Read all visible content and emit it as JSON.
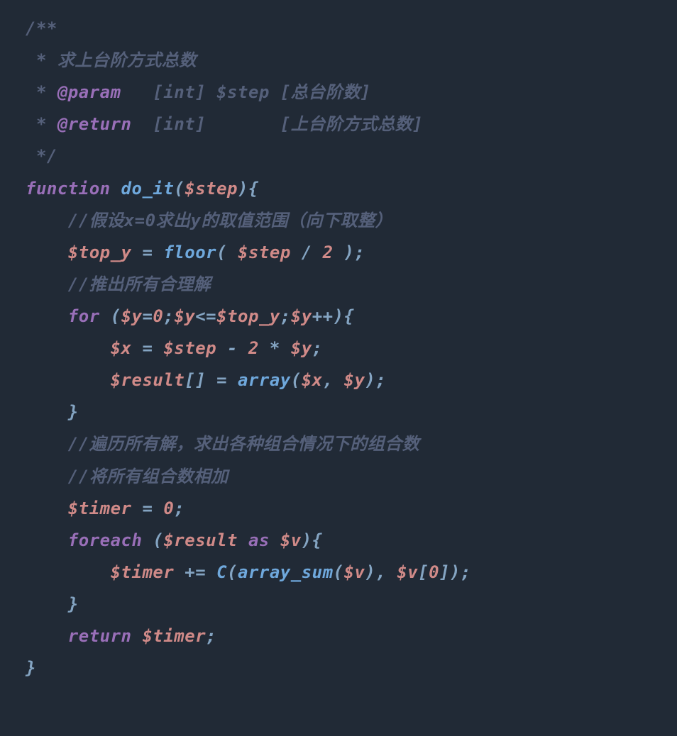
{
  "code": {
    "line1": {
      "a": "/**"
    },
    "line2": {
      "a": " * 求上台阶方式总数"
    },
    "line3": {
      "a": " * ",
      "b": "@param",
      "c": "   [int] $step [总台阶数]"
    },
    "line4": {
      "a": " * ",
      "b": "@return",
      "c": "  [int]       [上台阶方式总数]"
    },
    "line5": {
      "a": " */"
    },
    "line6": {
      "a": "function",
      "b": " ",
      "c": "do_it",
      "d": "(",
      "e": "$step",
      "f": "){"
    },
    "line7": {
      "a": "    ",
      "b": "//假设x=0求出y的取值范围（向下取整）"
    },
    "line8": {
      "a": "    ",
      "b": "$top_y",
      "c": " = ",
      "d": "floor",
      "e": "( ",
      "f": "$step",
      "g": " / ",
      "h": "2",
      "i": " );"
    },
    "line9": {
      "a": "    ",
      "b": "//推出所有合理解"
    },
    "line10": {
      "a": "    ",
      "b": "for",
      "c": " (",
      "d": "$y",
      "e": "=",
      "f": "0",
      "g": ";",
      "h": "$y",
      "i": "<=",
      "j": "$top_y",
      "k": ";",
      "l": "$y",
      "m": "++){"
    },
    "line11": {
      "a": "        ",
      "b": "$x",
      "c": " = ",
      "d": "$step",
      "e": " - ",
      "f": "2",
      "g": " * ",
      "h": "$y",
      "i": ";"
    },
    "line12": {
      "a": "        ",
      "b": "$result",
      "c": "[] = ",
      "d": "array",
      "e": "(",
      "f": "$x",
      "g": ", ",
      "h": "$y",
      "i": ");"
    },
    "line13": {
      "a": "    }"
    },
    "line14": {
      "a": "    ",
      "b": "//遍历所有解，求出各种组合情况下的组合数"
    },
    "line15": {
      "a": "    ",
      "b": "//将所有组合数相加"
    },
    "line16": {
      "a": "    ",
      "b": "$timer",
      "c": " = ",
      "d": "0",
      "e": ";"
    },
    "line17": {
      "a": "    ",
      "b": "foreach",
      "c": " (",
      "d": "$result",
      "e": " ",
      "f": "as",
      "g": " ",
      "h": "$v",
      "i": "){"
    },
    "line18": {
      "a": "        ",
      "b": "$timer",
      "c": " += ",
      "d": "C",
      "e": "(",
      "f": "array_sum",
      "g": "(",
      "h": "$v",
      "i": "), ",
      "j": "$v",
      "k": "[",
      "l": "0",
      "m": "]);"
    },
    "line19": {
      "a": "    }"
    },
    "line20": {
      "a": "    ",
      "b": "return",
      "c": " ",
      "d": "$timer",
      "e": ";"
    },
    "line21": {
      "a": "}"
    }
  }
}
